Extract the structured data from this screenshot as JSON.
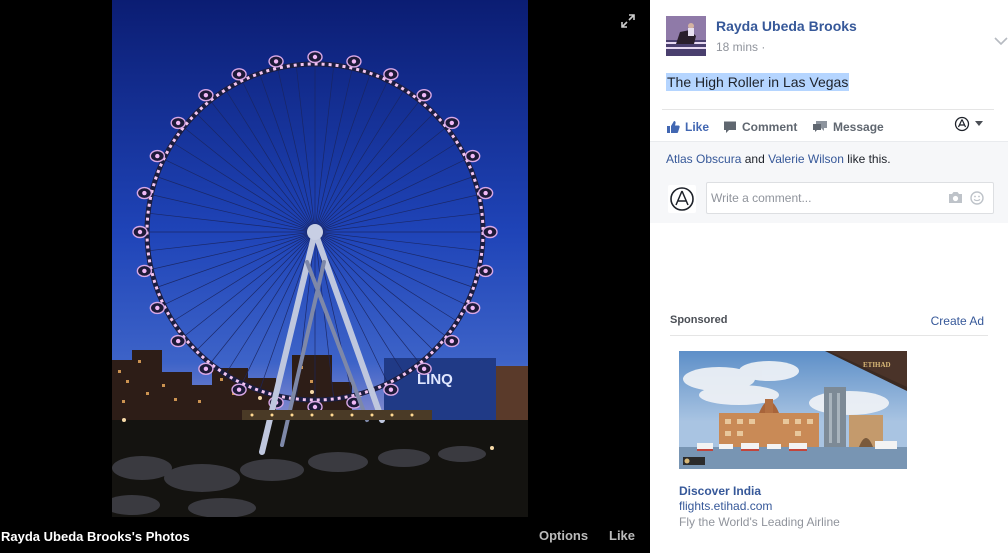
{
  "viewer": {
    "album_title": "Rayda Ubeda Brooks's Photos",
    "options_label": "Options",
    "like_label": "Like",
    "building_sign": "LINQ"
  },
  "post": {
    "author": "Rayda Ubeda Brooks",
    "time": "18 mins",
    "caption": "The High Roller in Las Vegas",
    "actions": {
      "like": "Like",
      "comment": "Comment",
      "message": "Message"
    },
    "likes": {
      "person1": "Atlas Obscura",
      "connector": "and",
      "person2": "Valerie Wilson",
      "suffix": "like this."
    },
    "comment_placeholder": "Write a comment..."
  },
  "sponsored": {
    "heading": "Sponsored",
    "create_ad": "Create Ad",
    "ad": {
      "title": "Discover India",
      "url": "flights.etihad.com",
      "description": "Fly the World's Leading Airline",
      "brand": "ETIHAD"
    }
  },
  "colors": {
    "link": "#365899",
    "like_blue": "#4267b2",
    "wheel_lights": "#f4c6f0",
    "sky_top": "#0b1f7a",
    "sky_bottom": "#e8a878"
  }
}
